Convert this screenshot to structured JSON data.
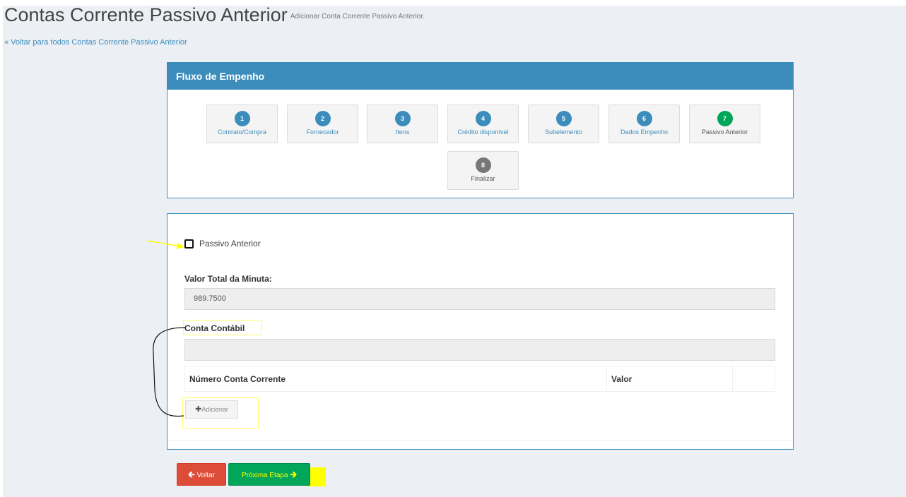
{
  "page": {
    "title": "Contas Corrente Passivo Anterior",
    "subtitle": "Adicionar Conta Corrente Passivo Anterior.",
    "back_link": "« Voltar para todos Contas Corrente Passivo Anterior"
  },
  "flow": {
    "header": "Fluxo de Empenho",
    "steps": [
      {
        "num": "1",
        "label": "Contrato/Compra",
        "state": "active"
      },
      {
        "num": "2",
        "label": "Fornecedor",
        "state": "active"
      },
      {
        "num": "3",
        "label": "Itens",
        "state": "active"
      },
      {
        "num": "4",
        "label": "Crédito disponível",
        "state": "active"
      },
      {
        "num": "5",
        "label": "Subelemento",
        "state": "active"
      },
      {
        "num": "6",
        "label": "Dados Empenho",
        "state": "active"
      },
      {
        "num": "7",
        "label": "Passivo Anterior",
        "state": "current"
      },
      {
        "num": "8",
        "label": "Finalizar",
        "state": "pending"
      }
    ]
  },
  "form": {
    "checkbox_label": "Passivo Anterior",
    "valor_total_label": "Valor Total da Minuta:",
    "valor_total_value": "989.7500",
    "conta_contabil_label": "Conta Contábil",
    "conta_contabil_value": "",
    "table_headers": [
      "Número Conta Corrente",
      "Valor",
      ""
    ],
    "add_label": "Adicionar"
  },
  "buttons": {
    "back": "Voltar",
    "next": "Próxima Etapa"
  },
  "colors": {
    "primary": "#3c8dbc",
    "success": "#00a65a",
    "danger": "#dd4b39",
    "annotation": "#ffff00"
  }
}
